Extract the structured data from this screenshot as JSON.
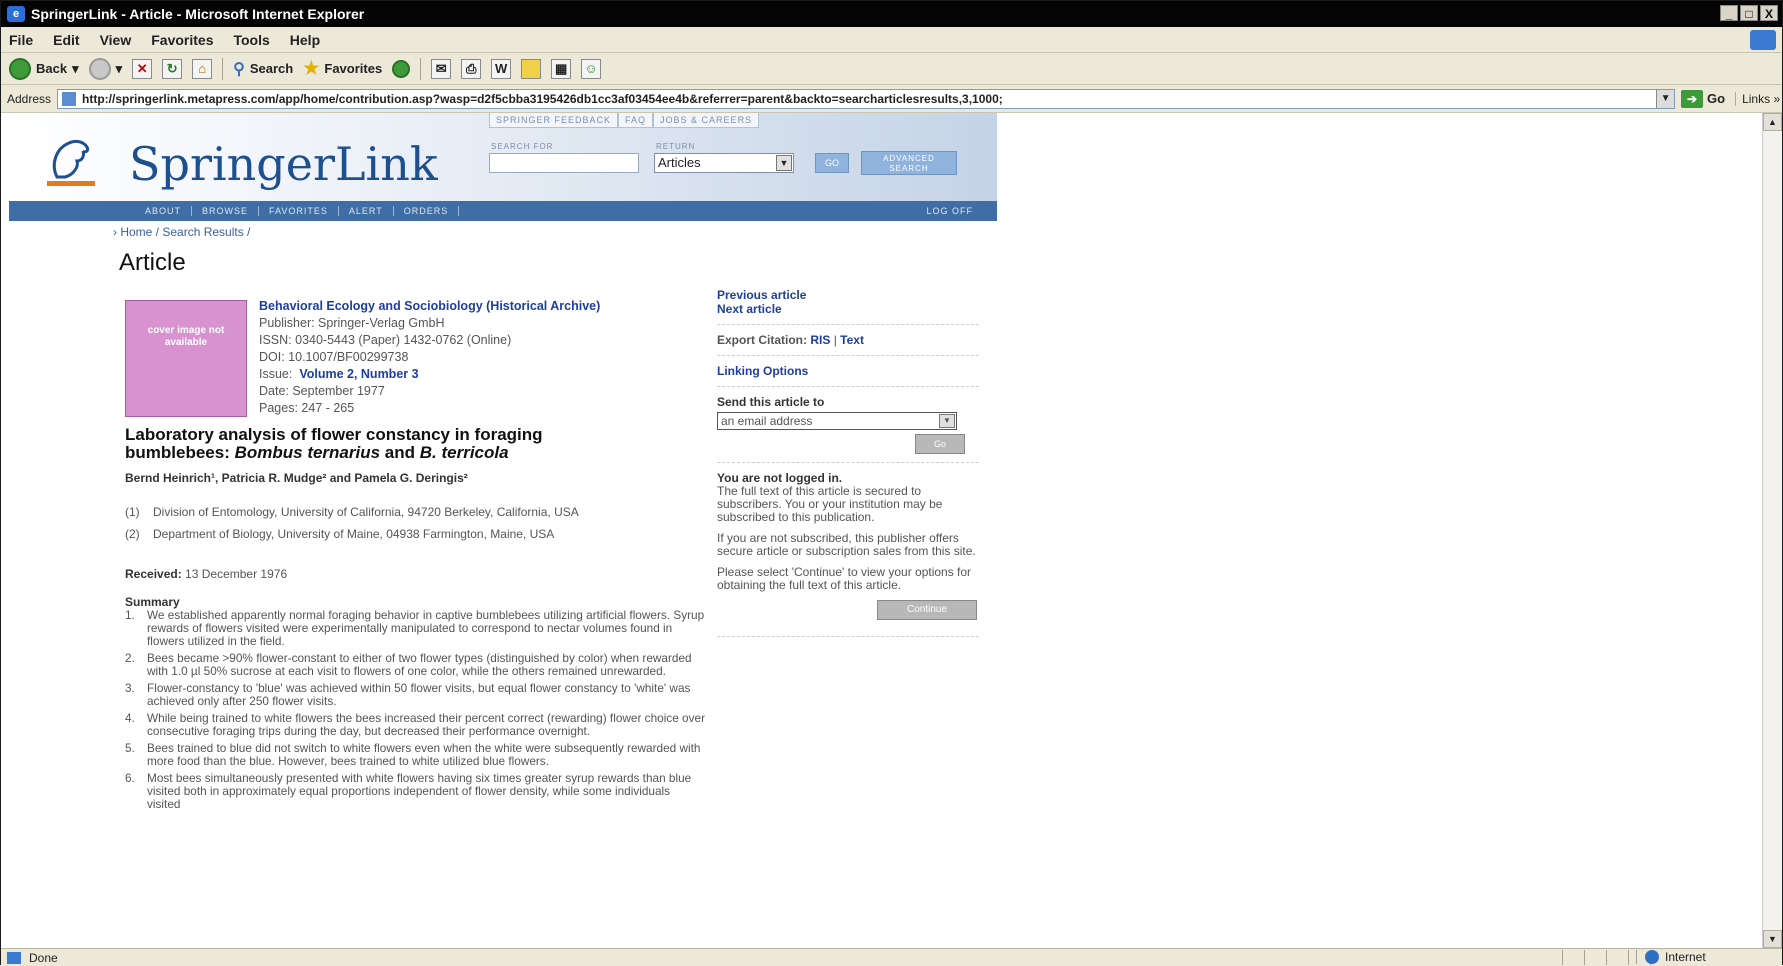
{
  "window": {
    "title": "SpringerLink - Article - Microsoft Internet Explorer",
    "min": "_",
    "max": "□",
    "close": "X"
  },
  "menu": [
    "File",
    "Edit",
    "View",
    "Favorites",
    "Tools",
    "Help"
  ],
  "toolbar": {
    "back": "Back",
    "search": "Search",
    "favorites": "Favorites"
  },
  "address": {
    "label": "Address",
    "url": "http://springerlink.metapress.com/app/home/contribution.asp?wasp=d2f5cbba3195426db1cc3af03454ee4b&referrer=parent&backto=searcharticlesresults,3,1000;",
    "go": "Go",
    "links": "Links"
  },
  "springer": {
    "logo": "SpringerLink",
    "toplinks": [
      "SPRINGER FEEDBACK",
      "FAQ",
      "JOBS & CAREERS"
    ],
    "search_for_label": "SEARCH FOR",
    "return_label": "RETURN",
    "return_value": "Articles",
    "go": "GO",
    "advanced": "ADVANCED SEARCH",
    "nav": [
      "ABOUT",
      "BROWSE",
      "FAVORITES",
      "ALERT",
      "ORDERS"
    ],
    "logoff": "LOG OFF"
  },
  "breadcrumb": "› Home / Search Results /",
  "heading": "Article",
  "cover_text": "cover image not available",
  "journal": {
    "title": "Behavioral Ecology and Sociobiology (Historical Archive)",
    "publisher": "Publisher: Springer-Verlag GmbH",
    "issn": "ISSN: 0340-5443 (Paper) 1432-0762 (Online)",
    "doi": "DOI: 10.1007/BF00299738",
    "issue_label": "Issue:",
    "issue": "Volume 2, Number 3",
    "date": "Date:  September 1977",
    "pages": "Pages:  247 - 265"
  },
  "article": {
    "title_line1": "Laboratory analysis of flower constancy in foraging",
    "title_line2a": "bumblebees: ",
    "title_line2b": "Bombus ternarius",
    "title_line2c": " and ",
    "title_line2d": "B. terricola",
    "authors": "Bernd Heinrich¹, Patricia R. Mudge² and Pamela G. Deringis²",
    "affil": [
      {
        "n": "(1)",
        "text": "Division of Entomology, University of California, 94720 Berkeley, California, USA"
      },
      {
        "n": "(2)",
        "text": "Department of Biology, University of Maine, 04938 Farmington, Maine, USA"
      }
    ],
    "received_label": "Received:",
    "received": "13 December 1976",
    "summary_label": "Summary",
    "summary": [
      {
        "n": "1.",
        "text": "We established apparently normal foraging behavior in captive bumblebees utilizing artificial flowers. Syrup rewards of flowers visited were experimentally manipulated to correspond to nectar volumes found in flowers utilized in the field."
      },
      {
        "n": "2.",
        "text": "Bees became >90% flower-constant to either of two flower types (distinguished by color) when rewarded with 1.0 µl 50% sucrose at each visit to flowers of one color, while the others remained unrewarded."
      },
      {
        "n": "3.",
        "text": "Flower-constancy to 'blue' was achieved within 50 flower visits, but equal flower constancy to 'white' was achieved only after 250 flower visits."
      },
      {
        "n": "4.",
        "text": "While being trained to white flowers the bees increased their percent correct (rewarding) flower choice over consecutive foraging trips during the day, but decreased their performance overnight."
      },
      {
        "n": "5.",
        "text": "Bees trained to blue did not switch to white flowers even when the white were subsequently rewarded with more food than the blue. However, bees trained to white utilized blue flowers."
      },
      {
        "n": "6.",
        "text": "Most bees simultaneously presented with white flowers having six times greater syrup rewards than blue visited both in approximately equal proportions independent of flower density, while some individuals visited"
      }
    ]
  },
  "right": {
    "prev": "Previous article",
    "next": "Next article",
    "export_label": "Export Citation:",
    "ris": "RIS",
    "text": "Text",
    "linking": "Linking Options",
    "send_label": "Send this article to",
    "send_value": "an email address",
    "go": "Go",
    "not_logged": "You are not logged in.",
    "p1": "The full text of this article is secured to subscribers. You or your institution may be subscribed to this publication.",
    "p2": "If you are not subscribed, this publisher offers secure article or subscription sales from this site.",
    "p3": "Please select 'Continue' to view your options for obtaining the full text of this article.",
    "continue": "Continue"
  },
  "status": {
    "text": "Done",
    "zone": "Internet"
  }
}
